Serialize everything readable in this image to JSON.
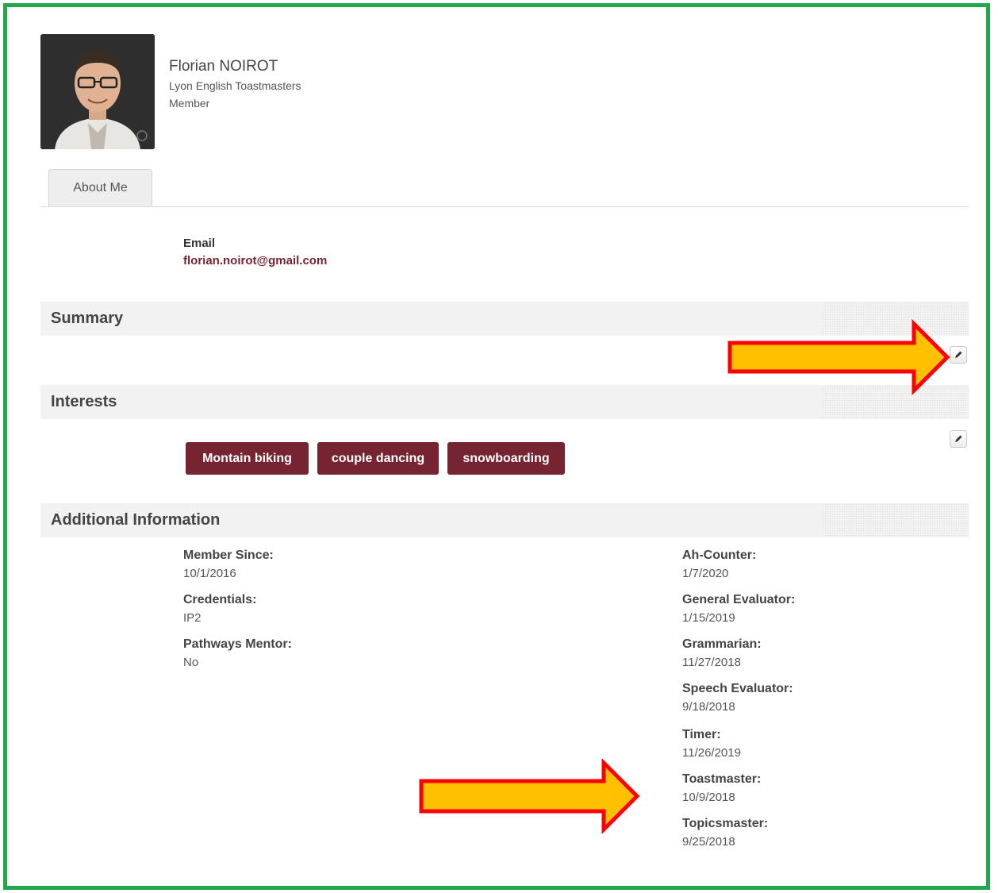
{
  "profile": {
    "name": "Florian NOIROT",
    "club": "Lyon English Toastmasters",
    "role": "Member"
  },
  "tabs": [
    {
      "label": "About Me"
    }
  ],
  "email": {
    "label": "Email",
    "value": "florian.noirot@gmail.com"
  },
  "summary": {
    "title": "Summary"
  },
  "interests": {
    "title": "Interests",
    "items": [
      "Montain biking",
      "couple dancing",
      "snowboarding"
    ]
  },
  "additional": {
    "title": "Additional Information",
    "left": [
      {
        "label": "Member Since:",
        "value": "10/1/2016"
      },
      {
        "label": "Credentials:",
        "value": "IP2"
      },
      {
        "label": "Pathways Mentor:",
        "value": "No"
      }
    ],
    "right": [
      {
        "label": "Ah-Counter:",
        "value": "1/7/2020"
      },
      {
        "label": "General Evaluator:",
        "value": "1/15/2019"
      },
      {
        "label": "Grammarian:",
        "value": "11/27/2018"
      },
      {
        "label": "Speech Evaluator:",
        "value": "9/18/2018"
      },
      {
        "label": "Timer:",
        "value": "11/26/2019"
      },
      {
        "label": "Toastmaster:",
        "value": "10/9/2018"
      },
      {
        "label": "Topicsmaster:",
        "value": "9/25/2018"
      }
    ]
  },
  "icons": {
    "edit": "pencil-icon",
    "annotation": "arrow-icon"
  },
  "colors": {
    "frame": "#22a84a",
    "brand": "#772432",
    "arrow_fill": "#ffc000",
    "arrow_stroke": "#ff0000"
  }
}
